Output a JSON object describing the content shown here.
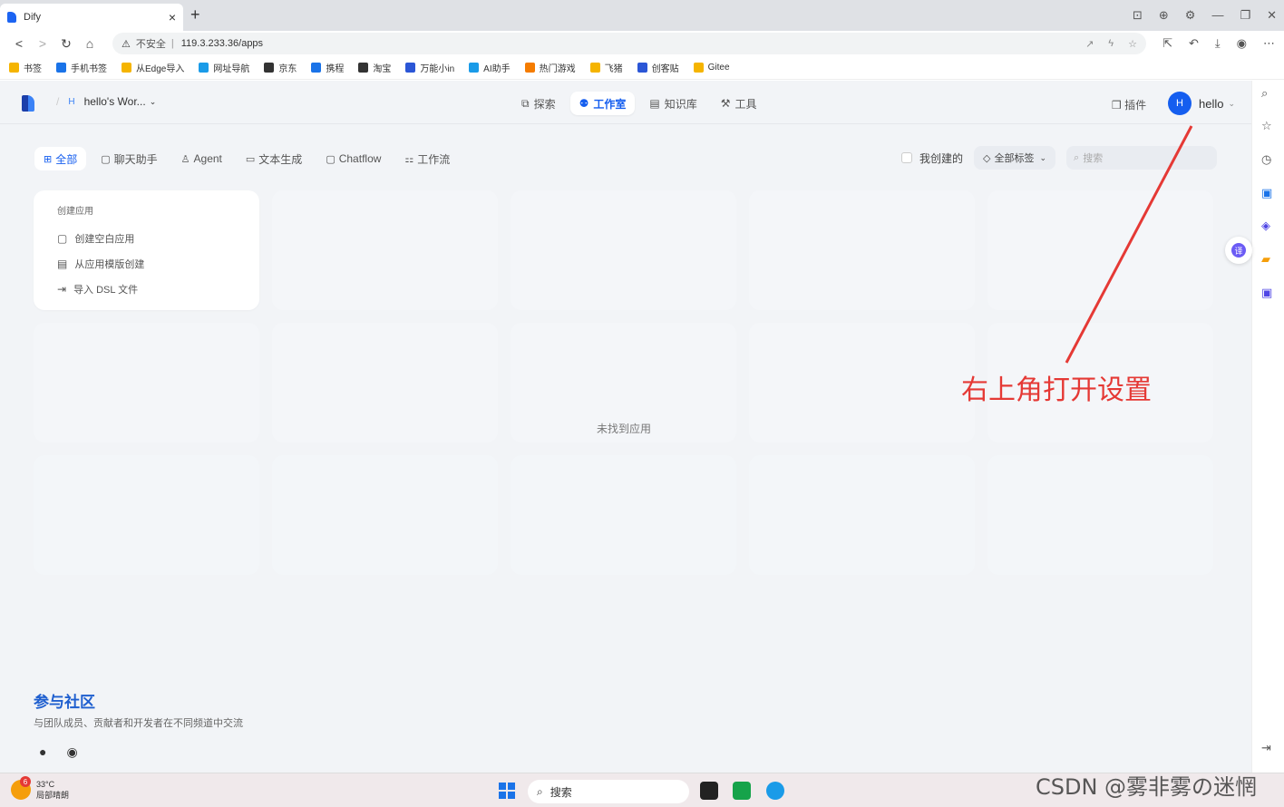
{
  "browser": {
    "tab_title": "Dify",
    "tab_close": "×",
    "new_tab": "+",
    "insecure_label": "不安全",
    "url": "119.3.233.36/apps",
    "bookmarks": [
      {
        "label": "书签",
        "color": "#f5b400"
      },
      {
        "label": "手机书签",
        "color": "#1a73e8"
      },
      {
        "label": "从Edge导入",
        "color": "#f5b400"
      },
      {
        "label": "网址导航",
        "color": "#1a9be8"
      },
      {
        "label": "京东",
        "color": "#333333"
      },
      {
        "label": "携程",
        "color": "#1a73e8"
      },
      {
        "label": "淘宝",
        "color": "#333333"
      },
      {
        "label": "万能小in",
        "color": "#2b56d6"
      },
      {
        "label": "AI助手",
        "color": "#1a9be8"
      },
      {
        "label": "热门游戏",
        "color": "#f57c00"
      },
      {
        "label": "飞猪",
        "color": "#f5b400"
      },
      {
        "label": "创客贴",
        "color": "#2b56d6"
      },
      {
        "label": "Gitee",
        "color": "#f5b400"
      }
    ]
  },
  "header": {
    "workspace_initial": "H",
    "workspace_name": "hello's Wor...",
    "nav": [
      {
        "label": "探索",
        "icon": "explore-icon"
      },
      {
        "label": "工作室",
        "icon": "robot-icon"
      },
      {
        "label": "知识库",
        "icon": "book-icon"
      },
      {
        "label": "工具",
        "icon": "tool-icon"
      }
    ],
    "plugin_label": "插件",
    "user_initial": "H",
    "user_name": "hello"
  },
  "filters": {
    "tabs": [
      "全部",
      "聊天助手",
      "Agent",
      "文本生成",
      "Chatflow",
      "工作流"
    ],
    "created_by_me": "我创建的",
    "all_tags": "全部标签",
    "search_placeholder": "搜索"
  },
  "create_card": {
    "title": "创建应用",
    "items": [
      "创建空白应用",
      "从应用模版创建",
      "导入 DSL 文件"
    ]
  },
  "empty_text": "未找到应用",
  "community": {
    "title": "参与社区",
    "subtitle": "与团队成员、贡献者和开发者在不同频道中交流"
  },
  "annotation": {
    "text": "右上角打开设置",
    "color": "#e53935"
  },
  "taskbar": {
    "weather_badge": "6",
    "temperature": "33°C",
    "weather_desc": "局部晴朗",
    "search_label": "搜索"
  },
  "watermark": "CSDN @雾非雾の迷惘"
}
